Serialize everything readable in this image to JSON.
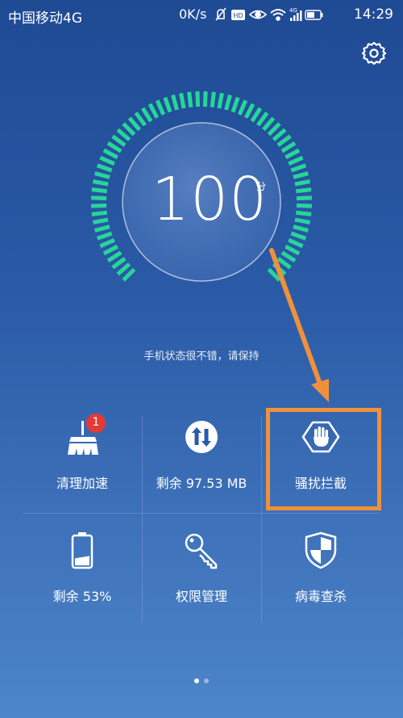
{
  "status_bar": {
    "carrier": "中国移动4G",
    "speed": "0K/s",
    "hd_badge": "HD",
    "network": "4G",
    "time": "14:29"
  },
  "icons": {
    "settings": "gear-icon",
    "broom": "broom-icon",
    "transfer": "up-down-arrows-icon",
    "block": "hand-block-icon",
    "battery": "battery-icon",
    "key": "key-icon",
    "shield": "shield-icon"
  },
  "score": {
    "value": "100",
    "unit": "分",
    "message": "手机状态很不错，请保持",
    "gauge_level": 1.0
  },
  "tiles": [
    {
      "label": "清理加速",
      "badge": "1"
    },
    {
      "label": "剩余 97.53 MB"
    },
    {
      "label": "骚扰拦截"
    },
    {
      "label": "剩余 53%",
      "battery_level": 0.53
    },
    {
      "label": "权限管理"
    },
    {
      "label": "病毒查杀"
    }
  ],
  "pager": {
    "pages": 2,
    "current": 1
  },
  "colors": {
    "gauge": "#27d59a",
    "highlight": "#f0913a",
    "badge": "#e53935",
    "bg_top": "#1f4a94",
    "bg_bottom": "#4d86c9"
  }
}
